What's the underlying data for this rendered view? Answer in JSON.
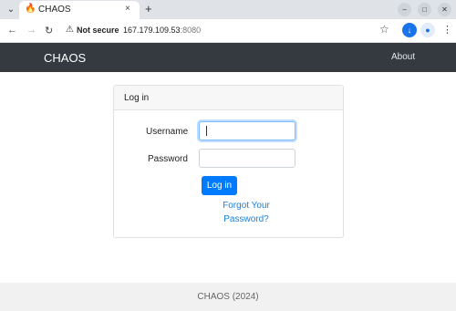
{
  "browser": {
    "tab_title": "CHAOS",
    "new_tab_glyph": "+",
    "tab_close_glyph": "×",
    "url_status": "Not secure",
    "url_host": "167.179.109.53",
    "url_port": ":8080"
  },
  "navbar": {
    "brand": "CHAOS",
    "about": "About"
  },
  "login": {
    "header": "Log in",
    "username_label": "Username",
    "username_value": "",
    "password_label": "Password",
    "password_value": "",
    "submit_label": "Log in",
    "forgot_label": "Forgot Your Password?"
  },
  "footer": {
    "text": "CHAOS (2024)"
  },
  "colors": {
    "navbar_bg": "#343a40",
    "primary": "#007bff",
    "link": "#1a7fd8"
  },
  "icons": [
    "tab-search-icon",
    "fire-favicon-icon",
    "close-icon",
    "plus-icon",
    "minimize-icon",
    "maximize-icon",
    "window-close-icon",
    "back-arrow-icon",
    "forward-arrow-icon",
    "reload-icon",
    "warning-icon",
    "star-icon",
    "download-icon",
    "profile-icon",
    "kebab-menu-icon"
  ]
}
